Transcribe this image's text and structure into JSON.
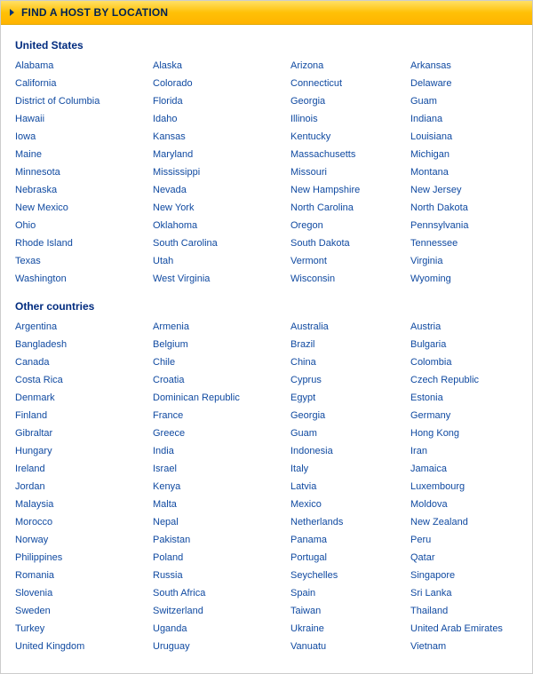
{
  "header": {
    "title": "FIND A HOST BY LOCATION"
  },
  "sections": [
    {
      "title": "United States",
      "items": [
        "Alabama",
        "Alaska",
        "Arizona",
        "Arkansas",
        "California",
        "Colorado",
        "Connecticut",
        "Delaware",
        "District of Columbia",
        "Florida",
        "Georgia",
        "Guam",
        "Hawaii",
        "Idaho",
        "Illinois",
        "Indiana",
        "Iowa",
        "Kansas",
        "Kentucky",
        "Louisiana",
        "Maine",
        "Maryland",
        "Massachusetts",
        "Michigan",
        "Minnesota",
        "Mississippi",
        "Missouri",
        "Montana",
        "Nebraska",
        "Nevada",
        "New Hampshire",
        "New Jersey",
        "New Mexico",
        "New York",
        "North Carolina",
        "North Dakota",
        "Ohio",
        "Oklahoma",
        "Oregon",
        "Pennsylvania",
        "Rhode Island",
        "South Carolina",
        "South Dakota",
        "Tennessee",
        "Texas",
        "Utah",
        "Vermont",
        "Virginia",
        "Washington",
        "West Virginia",
        "Wisconsin",
        "Wyoming"
      ]
    },
    {
      "title": "Other countries",
      "items": [
        "Argentina",
        "Armenia",
        "Australia",
        "Austria",
        "Bangladesh",
        "Belgium",
        "Brazil",
        "Bulgaria",
        "Canada",
        "Chile",
        "China",
        "Colombia",
        "Costa Rica",
        "Croatia",
        "Cyprus",
        "Czech Republic",
        "Denmark",
        "Dominican Republic",
        "Egypt",
        "Estonia",
        "Finland",
        "France",
        "Georgia",
        "Germany",
        "Gibraltar",
        "Greece",
        "Guam",
        "Hong Kong",
        "Hungary",
        "India",
        "Indonesia",
        "Iran",
        "Ireland",
        "Israel",
        "Italy",
        "Jamaica",
        "Jordan",
        "Kenya",
        "Latvia",
        "Luxembourg",
        "Malaysia",
        "Malta",
        "Mexico",
        "Moldova",
        "Morocco",
        "Nepal",
        "Netherlands",
        "New Zealand",
        "Norway",
        "Pakistan",
        "Panama",
        "Peru",
        "Philippines",
        "Poland",
        "Portugal",
        "Qatar",
        "Romania",
        "Russia",
        "Seychelles",
        "Singapore",
        "Slovenia",
        "South Africa",
        "Spain",
        "Sri Lanka",
        "Sweden",
        "Switzerland",
        "Taiwan",
        "Thailand",
        "Turkey",
        "Uganda",
        "Ukraine",
        "United Arab Emirates",
        "United Kingdom",
        "Uruguay",
        "Vanuatu",
        "Vietnam"
      ]
    }
  ]
}
